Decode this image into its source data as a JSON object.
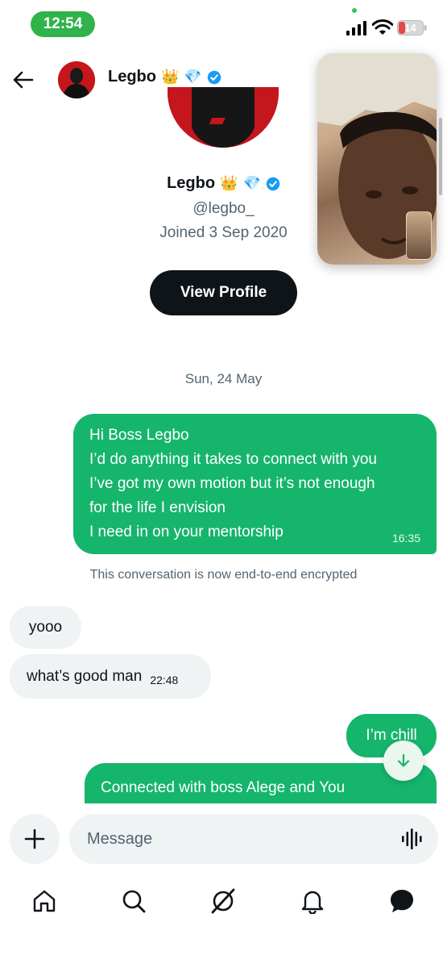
{
  "status_bar": {
    "time": "12:54",
    "battery": "14"
  },
  "header": {
    "name": "Legbo",
    "badges": [
      "👑",
      "💎"
    ]
  },
  "profile": {
    "name": "Legbo",
    "badges": [
      "👑",
      "💎"
    ],
    "handle": "@legbo_",
    "joined": "Joined 3 Sep 2020",
    "button_label": "View Profile"
  },
  "conversation": {
    "date_separator": "Sun, 24 May",
    "first_message": {
      "lines": [
        "Hi Boss Legbo",
        "I’d do anything it takes to connect with you",
        "I’ve got my own motion but it’s not enough",
        "for the life I envision",
        "I need in on your mentorship"
      ],
      "time": "16:35"
    },
    "encryption_note": "This conversation is now end-to-end encrypted",
    "reply_1": "yooo",
    "reply_2": {
      "text": "what’s good man",
      "time": "22:48"
    },
    "sent_2": "I’m chill",
    "sent_3": "Connected with boss Alege and You"
  },
  "composer": {
    "placeholder": "Message"
  },
  "colors": {
    "sent_bubble": "#15b56c",
    "received_bubble": "#eff3f4",
    "verified": "#1d9bf0"
  },
  "icons": {
    "nav": [
      "home-icon",
      "search-icon",
      "grok-icon",
      "notifications-icon",
      "messages-icon"
    ]
  }
}
